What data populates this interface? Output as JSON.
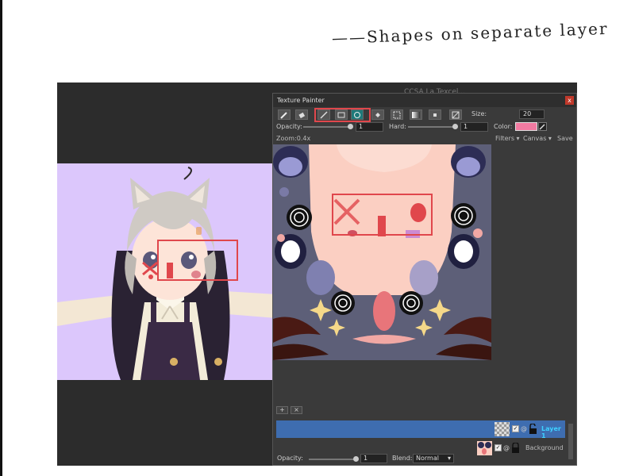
{
  "caption": "——Shapes on separate layer",
  "background_panel_title": "CCSA La Texcel...",
  "window": {
    "title": "Texture Painter",
    "close": "x"
  },
  "toolbar": {
    "tools": [
      "brush-tool",
      "eraser-tool",
      "line-tool",
      "rectangle-tool",
      "ellipse-tool",
      "fill-tool",
      "selection-tool",
      "gradient-tool",
      "stamp-tool",
      "transform-tool"
    ],
    "active_tool": "ellipse-tool",
    "size_label": "Size:",
    "size_value": "20"
  },
  "brush": {
    "opacity_label": "Opacity:",
    "opacity_value": "1",
    "hard_label": "Hard:",
    "hard_value": "1",
    "color_label": "Color:",
    "color": "#f27aa1"
  },
  "canvas_bar": {
    "zoom": "Zoom:0.4x",
    "filters": "Filters ▾",
    "canvas": "Canvas ▾",
    "save": "Save"
  },
  "layers": {
    "add": "+",
    "remove": "×",
    "items": [
      {
        "name": "Layer 1",
        "visible": true,
        "locked": false,
        "selected": true
      },
      {
        "name": "Background",
        "visible": true,
        "locked": true,
        "selected": false
      }
    ],
    "opacity_label": "Opacity:",
    "opacity_value": "1",
    "blend_label": "Blend:",
    "blend_value": "Normal"
  },
  "colors": {
    "accent": "#3e6db0",
    "highlight": "#e0474c",
    "active_tool": "#1e7a7a"
  }
}
